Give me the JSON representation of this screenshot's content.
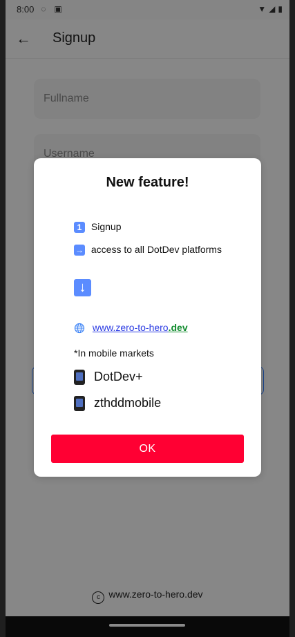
{
  "status_bar": {
    "time": "8:00"
  },
  "app_bar": {
    "title": "Signup"
  },
  "form": {
    "fields": [
      {
        "placeholder": "Fullname"
      },
      {
        "placeholder": "Username"
      }
    ]
  },
  "dialog": {
    "title": "New feature!",
    "lines": [
      {
        "icon": "1",
        "text": "Signup"
      },
      {
        "icon": "→",
        "text": "access to all DotDev platforms"
      },
      {
        "icon": "↓"
      }
    ],
    "website": {
      "text": "www.zero-to-hero",
      "tld": ".dev"
    },
    "mobile_markets_label": "*In mobile markets",
    "apps": [
      {
        "text": "DotDev+"
      },
      {
        "text": "zthddmobile"
      }
    ],
    "ok_label": "OK"
  },
  "footer": {
    "text": "www.zero-to-hero.dev"
  }
}
